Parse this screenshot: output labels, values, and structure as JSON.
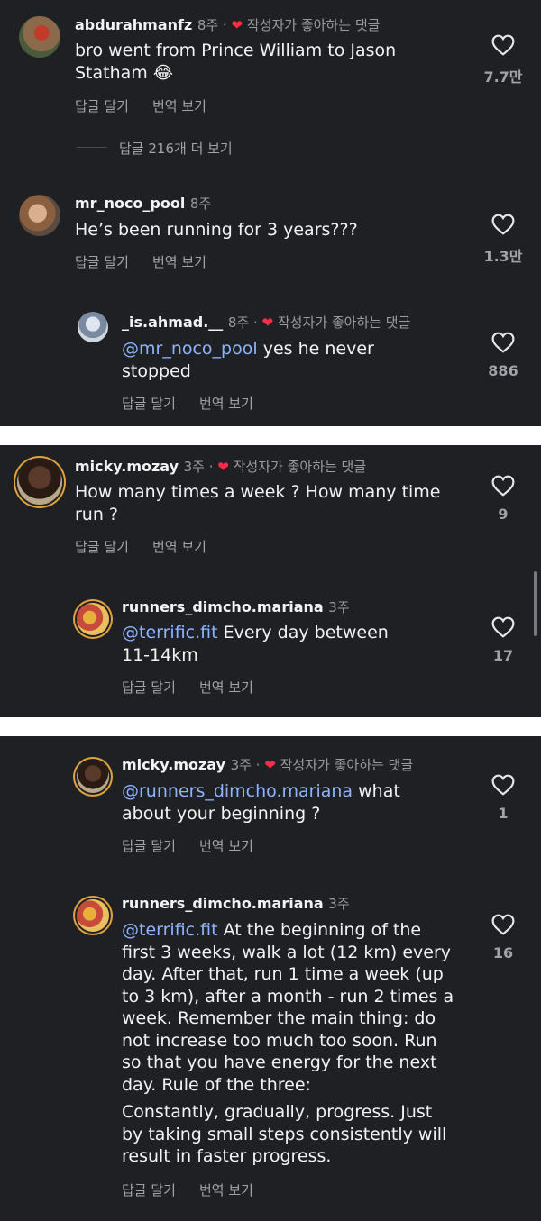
{
  "labels": {
    "reply": "답글 달기",
    "translate": "번역 보기",
    "liked_by_creator": "작성자가 좋아하는 댓글"
  },
  "panel1": {
    "c1": {
      "user": "abdurahmanfz",
      "time": "8주",
      "line1": "bro went from Prince William to Jason",
      "line2": "Statham 😂",
      "likes": "7.7만"
    },
    "view_more": "답글 216개 더 보기",
    "c2": {
      "user": "mr_noco_pool",
      "time": "8주",
      "text": "He’s been running for 3 years???",
      "likes": "1.3만"
    },
    "r1": {
      "user": "_is.ahmad.__",
      "time": "8주",
      "mention": "@mr_noco_pool",
      "line1_rest": " yes he never",
      "line2": "stopped",
      "likes": "886"
    }
  },
  "panel2": {
    "c1": {
      "user": "micky.mozay",
      "time": "3주",
      "line1": "How many times a week ? How many time",
      "line2": "run ?",
      "likes": "9"
    },
    "r1": {
      "user": "runners_dimcho.mariana",
      "time": "3주",
      "mention": "@terrific.fit",
      "line1_rest": " Every day between",
      "line2": "11-14km",
      "likes": "17"
    }
  },
  "panel3": {
    "r1": {
      "user": "micky.mozay",
      "time": "3주",
      "mention": "@runners_dimcho.mariana",
      "line1_rest": " what",
      "line2": "about your beginning ?",
      "likes": "1"
    },
    "r2": {
      "user": "runners_dimcho.mariana",
      "time": "3주",
      "mention": "@terrific.fit",
      "line1_rest": " At the beginning of the",
      "lines": [
        "first 3 weeks, walk a lot (12 km) every",
        "day. After that, run 1 time a week (up",
        "to 3 km), after a month - run 2 times a",
        "week. Remember the main thing: do",
        "not increase too much too soon. Run",
        "so that you have energy for the next",
        "day. Rule of the three:"
      ],
      "lines2": [
        "Constantly, gradually, progress. Just",
        "by taking small steps consistently will",
        "result in faster progress."
      ],
      "likes": "16"
    }
  }
}
